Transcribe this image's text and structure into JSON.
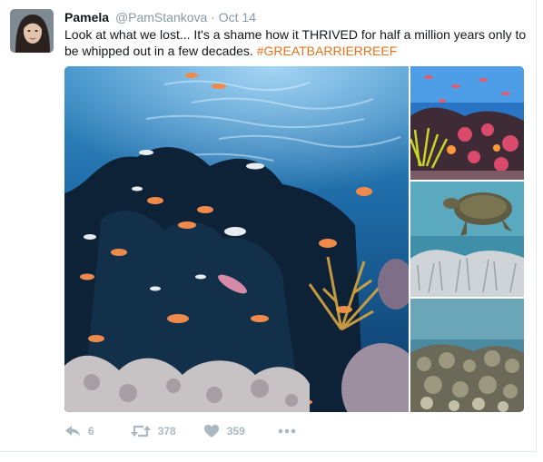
{
  "tweet": {
    "author_name": "Pamela",
    "handle": "@PamStankova",
    "separator": "·",
    "date": "Oct 14",
    "text": "Look at what we lost... It's a shame how it THRIVED for half a million years only to be whipped out in a few decades.",
    "hashtag": "#GREATBARRIERREEF"
  },
  "actions": {
    "reply_count": "6",
    "retweet_count": "378",
    "like_count": "359"
  },
  "icons": {
    "reply": "reply-icon",
    "retweet": "retweet-icon",
    "like": "heart-icon",
    "more": "more-dots-icon"
  },
  "colors": {
    "hashtag": "#e8721c",
    "action_icon": "#aab8c2",
    "meta_text": "#8899a6"
  }
}
